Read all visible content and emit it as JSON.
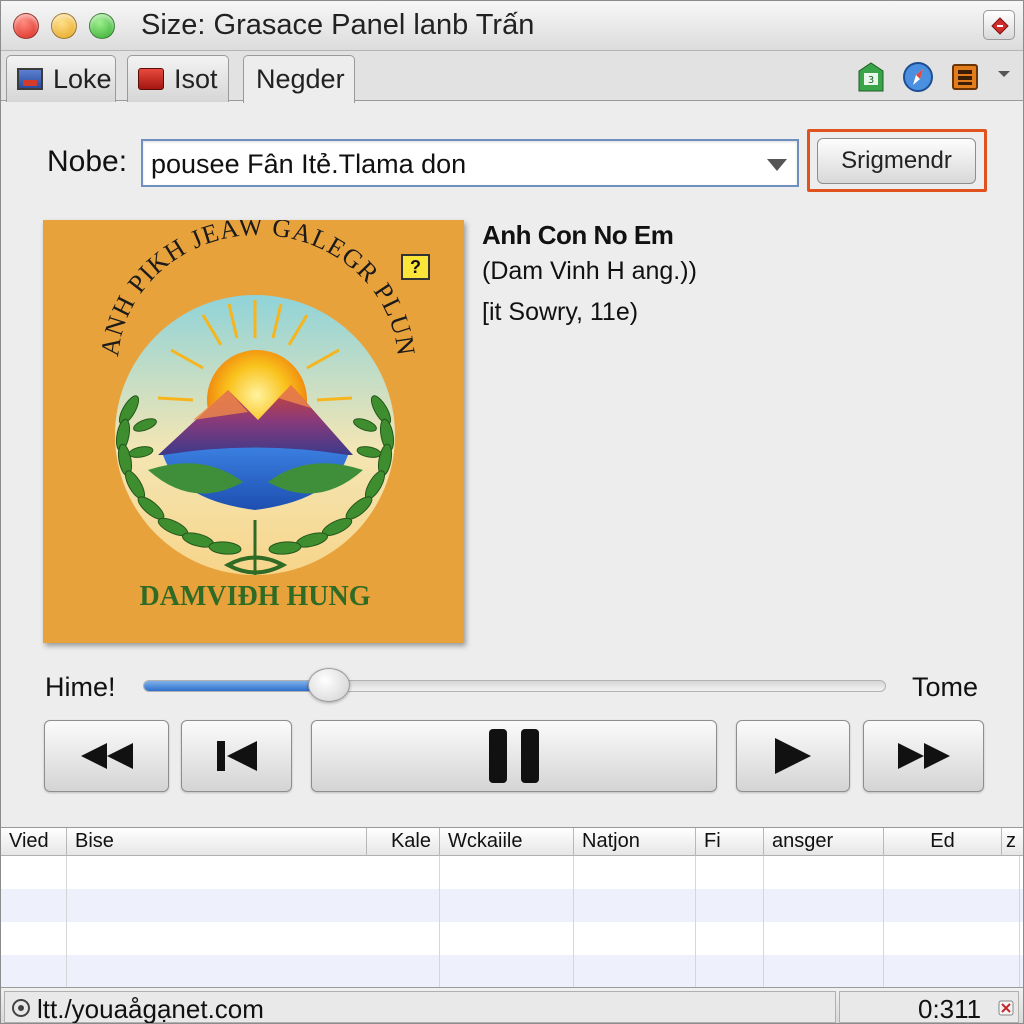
{
  "window": {
    "title": "Size: Grasace Panel Ɩanb Trấn"
  },
  "tabs": [
    {
      "label": "Loke",
      "icon": "picture-icon"
    },
    {
      "label": "Isot",
      "icon": "box-icon"
    },
    {
      "label": "Negder",
      "active": true
    }
  ],
  "toolbar_icons": [
    "calendar-icon",
    "compass-icon",
    "film-icon",
    "chevron-down-icon"
  ],
  "search": {
    "label": "Nobe:",
    "value": "pousee Fân Itẻ.Tlama don",
    "button_label": "Srigmendr",
    "highlight_color": "#e0521e"
  },
  "album": {
    "arc_text": "ANH PIKH JEAW GALEGR PLUN",
    "bottom_text": "DAMVIĐH HUNG",
    "badge": "?"
  },
  "track": {
    "title": "Anh Con No Em",
    "artist": "(Dam Vinh H ang.))",
    "meta": "[it Sowry, 11e)"
  },
  "progress": {
    "left_label": "Hime!",
    "right_label": "Tome",
    "fraction": 0.25
  },
  "transport": [
    "rewind-icon",
    "skip-back-icon",
    "pause-icon",
    "play-icon",
    "fast-forward-icon"
  ],
  "table": {
    "columns": [
      "Vied",
      "Bise",
      "Kale",
      "Wckaiile",
      "Natjon",
      "Fi",
      "ansger",
      "Ed",
      "z"
    ],
    "rows": [
      [],
      [],
      [],
      []
    ]
  },
  "status": {
    "url": "ltt./youaågạnet.com",
    "time": "0:311"
  },
  "colors": {
    "accent": "#2e6fcc",
    "album_bg": "#e8a23c",
    "album_text": "#2f6b24"
  }
}
